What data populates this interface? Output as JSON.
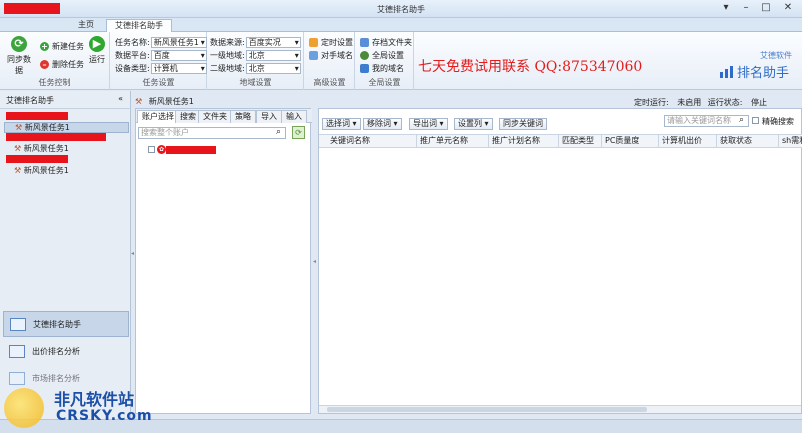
{
  "window": {
    "title": "艾德排名助手",
    "controls": [
      "▾",
      "–",
      "□",
      "✕"
    ]
  },
  "tabs": [
    {
      "label": "主页"
    },
    {
      "label": "艾德排名助手"
    }
  ],
  "ribbon": {
    "control_group": {
      "caption": "任务控制",
      "sync_label": "同步数据",
      "new_task_label": "新建任务",
      "delete_task_label": "删除任务",
      "run_label": "运行"
    },
    "task_settings": {
      "caption": "任务设置",
      "task_name_label": "任务名称:",
      "task_name_value": "新风景任务1",
      "platform_label": "数据平台:",
      "platform_value": "百度",
      "device_label": "设备类型:",
      "device_value": "计算机"
    },
    "region_settings": {
      "caption": "地域设置",
      "data_source_label": "数据来源:",
      "data_source_value": "百度实况",
      "region1_label": "一级地域:",
      "region1_value": "北京",
      "region2_label": "二级地域:",
      "region2_value": "北京"
    },
    "advanced": {
      "caption": "高级设置",
      "timer_label": "定时设置",
      "competitor_label": "对手域名"
    },
    "global": {
      "caption": "全局设置",
      "folder_label": "存档文件夹",
      "global_label": "全局设置",
      "mydomain_label": "我的域名"
    },
    "promo": "七天免费试用联系  QQ:875347060",
    "brand_small": "艾德软件",
    "brand": "排名助手"
  },
  "left_panel": {
    "title": "艾德排名助手",
    "collapse": "«",
    "tree": [
      {
        "label": "新风景任务1"
      },
      {
        "label": "新风景任务1"
      },
      {
        "label": "新风景任务1"
      }
    ],
    "nav": [
      {
        "label": "艾德排名助手"
      },
      {
        "label": "出价排名分析"
      },
      {
        "label": "市场排名分析"
      }
    ]
  },
  "breadcrumb": {
    "task": "新风景任务1",
    "timer_label": "定时运行:",
    "timer_value": "未启用",
    "status_label": "运行状态:",
    "status_value": "停止"
  },
  "account_panel": {
    "tabs": [
      "账户选择",
      "搜索",
      "文件夹",
      "策略",
      "导入",
      "输入"
    ],
    "search_placeholder": "搜索整个账户"
  },
  "keyword_panel": {
    "buttons": [
      "选择词",
      "移除词",
      "导出词",
      "设置列",
      "同步关键词"
    ],
    "search_placeholder": "请输入关键词名称",
    "exact_search_label": "精确搜索",
    "columns": [
      "关键词名称",
      "推广单元名称",
      "推广计划名称",
      "匹配类型",
      "PC质量度",
      "计算机出价",
      "获取状态",
      "sh需利"
    ]
  },
  "watermark": {
    "cn": "非凡软件站",
    "en": "CRSKY.com"
  },
  "colors": {
    "accent": "#2f6cc9",
    "promo_red": "#e31b1b",
    "redaction": "#e8141c"
  }
}
